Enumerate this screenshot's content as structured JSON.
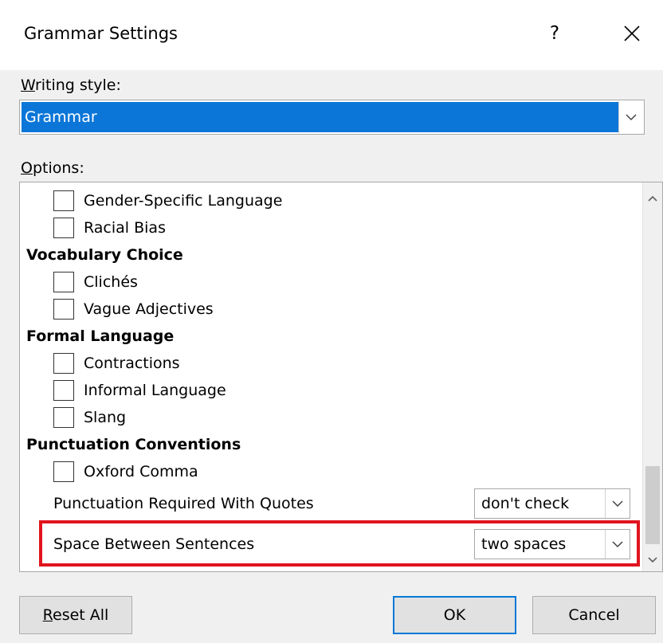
{
  "dialog": {
    "title": "Grammar Settings",
    "help_label": "?",
    "close_icon": "close-icon"
  },
  "writing_style": {
    "label_accel": "W",
    "label_rest": "riting style:",
    "selected": "Grammar",
    "arrow_icon": "chevron-down-icon"
  },
  "options": {
    "label_accel": "O",
    "label_rest": "ptions:",
    "items": [
      {
        "type": "checkbox",
        "label": "Gender-Specific Language",
        "checked": false
      },
      {
        "type": "checkbox",
        "label": "Racial Bias",
        "checked": false
      },
      {
        "type": "category",
        "label": "Vocabulary Choice"
      },
      {
        "type": "checkbox",
        "label": "Clichés",
        "checked": false
      },
      {
        "type": "checkbox",
        "label": "Vague Adjectives",
        "checked": false
      },
      {
        "type": "category",
        "label": "Formal Language"
      },
      {
        "type": "checkbox",
        "label": "Contractions",
        "checked": false
      },
      {
        "type": "checkbox",
        "label": "Informal Language",
        "checked": false
      },
      {
        "type": "checkbox",
        "label": "Slang",
        "checked": false
      },
      {
        "type": "category",
        "label": "Punctuation Conventions"
      },
      {
        "type": "checkbox",
        "label": "Oxford Comma",
        "checked": false
      },
      {
        "type": "select",
        "label": "Punctuation Required With Quotes",
        "value": "don't check"
      },
      {
        "type": "select",
        "label": "Space Between Sentences",
        "value": "two spaces"
      }
    ]
  },
  "buttons": {
    "reset_accel": "R",
    "reset_rest": "eset All",
    "ok": "OK",
    "cancel": "Cancel"
  },
  "colors": {
    "selection": "#0b76d8",
    "highlight_border": "#e0141e",
    "ok_border": "#0078d7"
  }
}
